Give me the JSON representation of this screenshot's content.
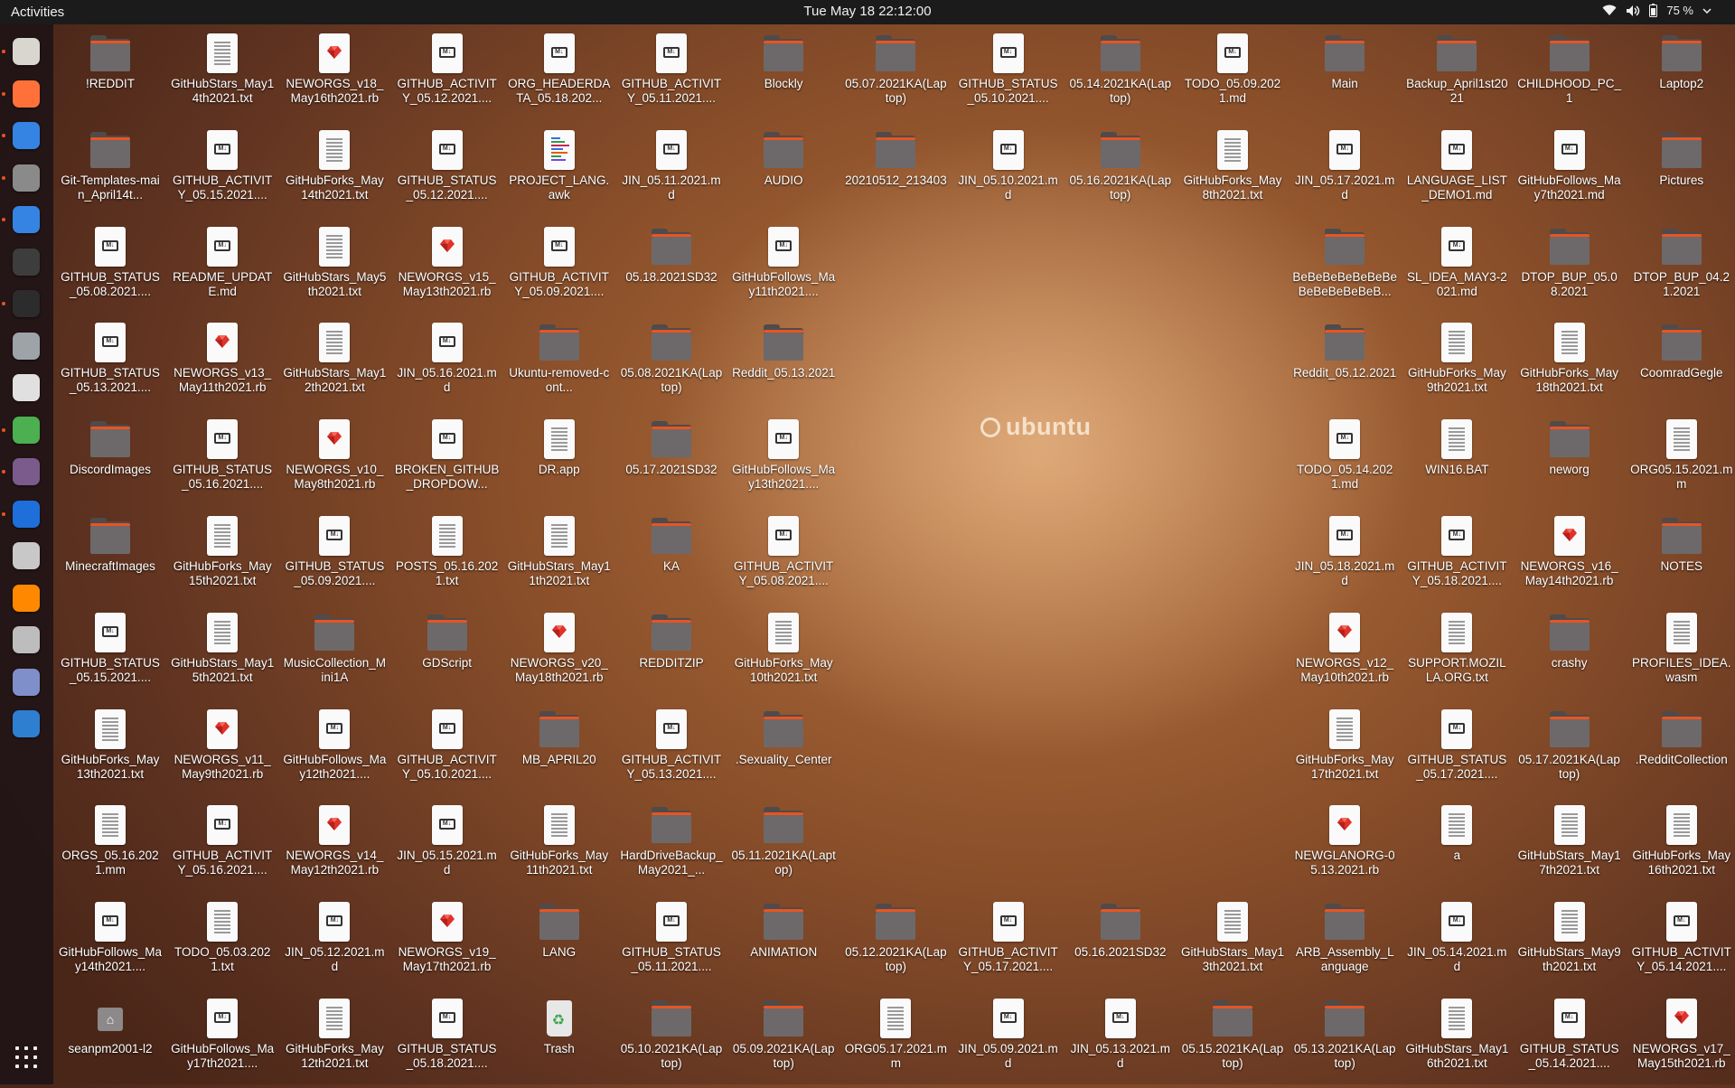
{
  "topbar": {
    "activities": "Activities",
    "clock": "Tue May 18  22:12:00",
    "battery_percent": "75 %"
  },
  "dock": [
    {
      "name": "files-icon",
      "color": "#d9d5cf",
      "running": true
    },
    {
      "name": "firefox-icon",
      "color": "#ff7139",
      "running": true
    },
    {
      "name": "text-editor-icon",
      "color": "#3584e4",
      "running": true
    },
    {
      "name": "settings-icon",
      "color": "#8a8a8a",
      "running": true
    },
    {
      "name": "help-icon",
      "color": "#3584e4",
      "running": true
    },
    {
      "name": "system-monitor-icon",
      "color": "#3d3d3d",
      "running": false
    },
    {
      "name": "terminal-icon",
      "color": "#2c2c2c",
      "running": true
    },
    {
      "name": "search-icon",
      "color": "#9ea3a8",
      "running": false
    },
    {
      "name": "sound-recorder-icon",
      "color": "#e0e0e0",
      "running": false
    },
    {
      "name": "extensions-icon",
      "color": "#4caf50",
      "running": true
    },
    {
      "name": "tweaks-icon",
      "color": "#7a5b8c",
      "running": true
    },
    {
      "name": "writer-icon",
      "color": "#1e6fd9",
      "running": true
    },
    {
      "name": "magnifier-icon",
      "color": "#c8c8c8",
      "running": false
    },
    {
      "name": "vlc-icon",
      "color": "#ff8800",
      "running": false
    },
    {
      "name": "disk-utility-icon",
      "color": "#bdbdbd",
      "running": false
    },
    {
      "name": "password-icon",
      "color": "#7f8fc9",
      "running": false
    },
    {
      "name": "virtualbox-icon",
      "color": "#2f7fd1",
      "running": false
    }
  ],
  "watermark": "ubuntu",
  "desktop_items": [
    {
      "col": 0,
      "row": 0,
      "type": "folder",
      "label": "!REDDIT"
    },
    {
      "col": 1,
      "row": 0,
      "type": "txt",
      "label": "GitHubStars_May14th2021.txt"
    },
    {
      "col": 2,
      "row": 0,
      "type": "rb",
      "label": "NEWORGS_v18_May16th2021.rb"
    },
    {
      "col": 3,
      "row": 0,
      "type": "md",
      "label": "GITHUB_ACTIVITY_05.12.2021...."
    },
    {
      "col": 4,
      "row": 0,
      "type": "md",
      "label": "ORG_HEADERDATA_05.18.202..."
    },
    {
      "col": 5,
      "row": 0,
      "type": "md",
      "label": "GITHUB_ACTIVITY_05.11.2021...."
    },
    {
      "col": 6,
      "row": 0,
      "type": "folder",
      "label": "Blockly"
    },
    {
      "col": 7,
      "row": 0,
      "type": "folder",
      "label": "05.07.2021KA(Laptop)"
    },
    {
      "col": 8,
      "row": 0,
      "type": "md",
      "label": "GITHUB_STATUS_05.10.2021...."
    },
    {
      "col": 9,
      "row": 0,
      "type": "folder",
      "label": "05.14.2021KA(Laptop)"
    },
    {
      "col": 10,
      "row": 0,
      "type": "md",
      "label": "TODO_05.09.2021.md"
    },
    {
      "col": 11,
      "row": 0,
      "type": "folder",
      "label": "Main"
    },
    {
      "col": 12,
      "row": 0,
      "type": "folder",
      "label": "Backup_April1st2021"
    },
    {
      "col": 13,
      "row": 0,
      "type": "folder",
      "label": "CHILDHOOD_PC_1"
    },
    {
      "col": 14,
      "row": 0,
      "type": "folder",
      "label": "Laptop2"
    },
    {
      "col": 0,
      "row": 1,
      "type": "folder",
      "label": "Git-Templates-main_April14t..."
    },
    {
      "col": 1,
      "row": 1,
      "type": "md",
      "label": "GITHUB_ACTIVITY_05.15.2021...."
    },
    {
      "col": 2,
      "row": 1,
      "type": "txt",
      "label": "GitHubForks_May14th2021.txt"
    },
    {
      "col": 3,
      "row": 1,
      "type": "md",
      "label": "GITHUB_STATUS_05.12.2021...."
    },
    {
      "col": 4,
      "row": 1,
      "type": "awk",
      "label": "PROJECT_LANG.awk"
    },
    {
      "col": 5,
      "row": 1,
      "type": "md",
      "label": "JIN_05.11.2021.md"
    },
    {
      "col": 6,
      "row": 1,
      "type": "folder",
      "label": "AUDIO"
    },
    {
      "col": 7,
      "row": 1,
      "type": "folder",
      "label": "20210512_213403"
    },
    {
      "col": 8,
      "row": 1,
      "type": "md",
      "label": "JIN_05.10.2021.md"
    },
    {
      "col": 9,
      "row": 1,
      "type": "folder",
      "label": "05.16.2021KA(Laptop)"
    },
    {
      "col": 10,
      "row": 1,
      "type": "txt",
      "label": "GitHubForks_May8th2021.txt"
    },
    {
      "col": 11,
      "row": 1,
      "type": "md",
      "label": "JIN_05.17.2021.md"
    },
    {
      "col": 12,
      "row": 1,
      "type": "md",
      "label": "LANGUAGE_LIST_DEMO1.md"
    },
    {
      "col": 13,
      "row": 1,
      "type": "md",
      "label": "GitHubFollows_May7th2021.md"
    },
    {
      "col": 14,
      "row": 1,
      "type": "folder",
      "label": "Pictures"
    },
    {
      "col": 0,
      "row": 2,
      "type": "md",
      "label": "GITHUB_STATUS_05.08.2021...."
    },
    {
      "col": 1,
      "row": 2,
      "type": "md",
      "label": "README_UPDATE.md"
    },
    {
      "col": 2,
      "row": 2,
      "type": "txt",
      "label": "GitHubStars_May5th2021.txt"
    },
    {
      "col": 3,
      "row": 2,
      "type": "rb",
      "label": "NEWORGS_v15_May13th2021.rb"
    },
    {
      "col": 4,
      "row": 2,
      "type": "md",
      "label": "GITHUB_ACTIVITY_05.09.2021...."
    },
    {
      "col": 5,
      "row": 2,
      "type": "folder",
      "label": "05.18.2021SD32"
    },
    {
      "col": 6,
      "row": 2,
      "type": "md",
      "label": "GitHubFollows_May11th2021...."
    },
    {
      "col": 11,
      "row": 2,
      "type": "folder",
      "label": "BeBeBeBeBeBeBeBeBeBeBeBeB..."
    },
    {
      "col": 12,
      "row": 2,
      "type": "md",
      "label": "SL_IDEA_MAY3-2021.md"
    },
    {
      "col": 13,
      "row": 2,
      "type": "folder",
      "label": "DTOP_BUP_05.08.2021"
    },
    {
      "col": 14,
      "row": 2,
      "type": "folder",
      "label": "DTOP_BUP_04.21.2021"
    },
    {
      "col": 0,
      "row": 3,
      "type": "md",
      "label": "GITHUB_STATUS_05.13.2021...."
    },
    {
      "col": 1,
      "row": 3,
      "type": "rb",
      "label": "NEWORGS_v13_May11th2021.rb"
    },
    {
      "col": 2,
      "row": 3,
      "type": "txt",
      "label": "GitHubStars_May12th2021.txt"
    },
    {
      "col": 3,
      "row": 3,
      "type": "md",
      "label": "JIN_05.16.2021.md"
    },
    {
      "col": 4,
      "row": 3,
      "type": "folder",
      "label": "Ukuntu-removed-cont..."
    },
    {
      "col": 5,
      "row": 3,
      "type": "folder",
      "label": "05.08.2021KA(Laptop)"
    },
    {
      "col": 6,
      "row": 3,
      "type": "folder",
      "label": "Reddit_05.13.2021"
    },
    {
      "col": 11,
      "row": 3,
      "type": "folder",
      "label": "Reddit_05.12.2021"
    },
    {
      "col": 12,
      "row": 3,
      "type": "txt",
      "label": "GitHubForks_May9th2021.txt"
    },
    {
      "col": 13,
      "row": 3,
      "type": "txt",
      "label": "GitHubForks_May18th2021.txt"
    },
    {
      "col": 14,
      "row": 3,
      "type": "folder",
      "label": "CoomradGegle"
    },
    {
      "col": 0,
      "row": 4,
      "type": "folder",
      "label": "DiscordImages"
    },
    {
      "col": 1,
      "row": 4,
      "type": "md",
      "label": "GITHUB_STATUS_05.16.2021...."
    },
    {
      "col": 2,
      "row": 4,
      "type": "rb",
      "label": "NEWORGS_v10_May8th2021.rb"
    },
    {
      "col": 3,
      "row": 4,
      "type": "md",
      "label": "BROKEN_GITHUB_DROPDOW..."
    },
    {
      "col": 4,
      "row": 4,
      "type": "txt",
      "label": "DR.app"
    },
    {
      "col": 5,
      "row": 4,
      "type": "folder",
      "label": "05.17.2021SD32"
    },
    {
      "col": 6,
      "row": 4,
      "type": "md",
      "label": "GitHubFollows_May13th2021...."
    },
    {
      "col": 11,
      "row": 4,
      "type": "md",
      "label": "TODO_05.14.2021.md"
    },
    {
      "col": 12,
      "row": 4,
      "type": "txt",
      "label": "WIN16.BAT"
    },
    {
      "col": 13,
      "row": 4,
      "type": "folder",
      "label": "neworg"
    },
    {
      "col": 14,
      "row": 4,
      "type": "txt",
      "label": "ORG05.15.2021.mm"
    },
    {
      "col": 0,
      "row": 5,
      "type": "folder",
      "label": "MinecraftImages"
    },
    {
      "col": 1,
      "row": 5,
      "type": "txt",
      "label": "GitHubForks_May15th2021.txt"
    },
    {
      "col": 2,
      "row": 5,
      "type": "md",
      "label": "GITHUB_STATUS_05.09.2021...."
    },
    {
      "col": 3,
      "row": 5,
      "type": "txt",
      "label": "POSTS_05.16.2021.txt"
    },
    {
      "col": 4,
      "row": 5,
      "type": "txt",
      "label": "GitHubStars_May11th2021.txt"
    },
    {
      "col": 5,
      "row": 5,
      "type": "folder",
      "label": "KA"
    },
    {
      "col": 6,
      "row": 5,
      "type": "md",
      "label": "GITHUB_ACTIVITY_05.08.2021...."
    },
    {
      "col": 11,
      "row": 5,
      "type": "md",
      "label": "JIN_05.18.2021.md"
    },
    {
      "col": 12,
      "row": 5,
      "type": "md",
      "label": "GITHUB_ACTIVITY_05.18.2021...."
    },
    {
      "col": 13,
      "row": 5,
      "type": "rb",
      "label": "NEWORGS_v16_May14th2021.rb"
    },
    {
      "col": 14,
      "row": 5,
      "type": "folder",
      "label": "NOTES"
    },
    {
      "col": 0,
      "row": 6,
      "type": "md",
      "label": "GITHUB_STATUS_05.15.2021...."
    },
    {
      "col": 1,
      "row": 6,
      "type": "txt",
      "label": "GitHubStars_May15th2021.txt"
    },
    {
      "col": 2,
      "row": 6,
      "type": "folder",
      "label": "MusicCollection_Mini1A"
    },
    {
      "col": 3,
      "row": 6,
      "type": "folder",
      "label": "GDScript"
    },
    {
      "col": 4,
      "row": 6,
      "type": "rb",
      "label": "NEWORGS_v20_May18th2021.rb"
    },
    {
      "col": 5,
      "row": 6,
      "type": "folder",
      "label": "REDDITZIP"
    },
    {
      "col": 6,
      "row": 6,
      "type": "txt",
      "label": "GitHubForks_May10th2021.txt"
    },
    {
      "col": 11,
      "row": 6,
      "type": "rb",
      "label": "NEWORGS_v12_May10th2021.rb"
    },
    {
      "col": 12,
      "row": 6,
      "type": "txt",
      "label": "SUPPORT.MOZILLA.ORG.txt"
    },
    {
      "col": 13,
      "row": 6,
      "type": "folder",
      "label": "crashy"
    },
    {
      "col": 14,
      "row": 6,
      "type": "txt",
      "label": "PROFILES_IDEA.wasm"
    },
    {
      "col": 0,
      "row": 7,
      "type": "txt",
      "label": "GitHubForks_May13th2021.txt"
    },
    {
      "col": 1,
      "row": 7,
      "type": "rb",
      "label": "NEWORGS_v11_May9th2021.rb"
    },
    {
      "col": 2,
      "row": 7,
      "type": "md",
      "label": "GitHubFollows_May12th2021...."
    },
    {
      "col": 3,
      "row": 7,
      "type": "md",
      "label": "GITHUB_ACTIVITY_05.10.2021...."
    },
    {
      "col": 4,
      "row": 7,
      "type": "folder",
      "label": "MB_APRIL20"
    },
    {
      "col": 5,
      "row": 7,
      "type": "md",
      "label": "GITHUB_ACTIVITY_05.13.2021...."
    },
    {
      "col": 6,
      "row": 7,
      "type": "folder",
      "label": ".Sexuality_Center"
    },
    {
      "col": 11,
      "row": 7,
      "type": "txt",
      "label": "GitHubForks_May17th2021.txt"
    },
    {
      "col": 12,
      "row": 7,
      "type": "md",
      "label": "GITHUB_STATUS_05.17.2021...."
    },
    {
      "col": 13,
      "row": 7,
      "type": "folder",
      "label": "05.17.2021KA(Laptop)"
    },
    {
      "col": 14,
      "row": 7,
      "type": "folder",
      "label": ".RedditCollection"
    },
    {
      "col": 0,
      "row": 8,
      "type": "txt",
      "label": "ORGS_05.16.2021.mm"
    },
    {
      "col": 1,
      "row": 8,
      "type": "md",
      "label": "GITHUB_ACTIVITY_05.16.2021...."
    },
    {
      "col": 2,
      "row": 8,
      "type": "rb",
      "label": "NEWORGS_v14_May12th2021.rb"
    },
    {
      "col": 3,
      "row": 8,
      "type": "md",
      "label": "JIN_05.15.2021.md"
    },
    {
      "col": 4,
      "row": 8,
      "type": "txt",
      "label": "GitHubForks_May11th2021.txt"
    },
    {
      "col": 5,
      "row": 8,
      "type": "folder",
      "label": "HardDriveBackup_May2021_..."
    },
    {
      "col": 6,
      "row": 8,
      "type": "folder",
      "label": "05.11.2021KA(Laptop)"
    },
    {
      "col": 11,
      "row": 8,
      "type": "rb",
      "label": "NEWGLANORG-05.13.2021.rb"
    },
    {
      "col": 12,
      "row": 8,
      "type": "txt",
      "label": "a"
    },
    {
      "col": 13,
      "row": 8,
      "type": "txt",
      "label": "GitHubStars_May17th2021.txt"
    },
    {
      "col": 14,
      "row": 8,
      "type": "txt",
      "label": "GitHubForks_May16th2021.txt"
    },
    {
      "col": 0,
      "row": 9,
      "type": "md",
      "label": "GitHubFollows_May14th2021...."
    },
    {
      "col": 1,
      "row": 9,
      "type": "txt",
      "label": "TODO_05.03.2021.txt"
    },
    {
      "col": 2,
      "row": 9,
      "type": "md",
      "label": "JIN_05.12.2021.md"
    },
    {
      "col": 3,
      "row": 9,
      "type": "rb",
      "label": "NEWORGS_v19_May17th2021.rb"
    },
    {
      "col": 4,
      "row": 9,
      "type": "folder",
      "label": "LANG"
    },
    {
      "col": 5,
      "row": 9,
      "type": "md",
      "label": "GITHUB_STATUS_05.11.2021...."
    },
    {
      "col": 6,
      "row": 9,
      "type": "folder",
      "label": "ANIMATION"
    },
    {
      "col": 7,
      "row": 9,
      "type": "folder",
      "label": "05.12.2021KA(Laptop)"
    },
    {
      "col": 8,
      "row": 9,
      "type": "md",
      "label": "GITHUB_ACTIVITY_05.17.2021...."
    },
    {
      "col": 9,
      "row": 9,
      "type": "folder",
      "label": "05.16.2021SD32"
    },
    {
      "col": 10,
      "row": 9,
      "type": "txt",
      "label": "GitHubStars_May13th2021.txt"
    },
    {
      "col": 11,
      "row": 9,
      "type": "folder",
      "label": "ARB_Assembly_Language"
    },
    {
      "col": 12,
      "row": 9,
      "type": "md",
      "label": "JIN_05.14.2021.md"
    },
    {
      "col": 13,
      "row": 9,
      "type": "txt",
      "label": "GitHubStars_May9th2021.txt"
    },
    {
      "col": 14,
      "row": 9,
      "type": "md",
      "label": "GITHUB_ACTIVITY_05.14.2021...."
    },
    {
      "col": 0,
      "row": 10,
      "type": "home",
      "label": "seanpm2001-l2"
    },
    {
      "col": 1,
      "row": 10,
      "type": "md",
      "label": "GitHubFollows_May17th2021...."
    },
    {
      "col": 2,
      "row": 10,
      "type": "txt",
      "label": "GitHubForks_May12th2021.txt"
    },
    {
      "col": 3,
      "row": 10,
      "type": "md",
      "label": "GITHUB_STATUS_05.18.2021...."
    },
    {
      "col": 4,
      "row": 10,
      "type": "trash",
      "label": "Trash"
    },
    {
      "col": 5,
      "row": 10,
      "type": "folder",
      "label": "05.10.2021KA(Laptop)"
    },
    {
      "col": 6,
      "row": 10,
      "type": "folder",
      "label": "05.09.2021KA(Laptop)"
    },
    {
      "col": 7,
      "row": 10,
      "type": "txt",
      "label": "ORG05.17.2021.mm"
    },
    {
      "col": 8,
      "row": 10,
      "type": "md",
      "label": "JIN_05.09.2021.md"
    },
    {
      "col": 9,
      "row": 10,
      "type": "md",
      "label": "JIN_05.13.2021.md"
    },
    {
      "col": 10,
      "row": 10,
      "type": "folder",
      "label": "05.15.2021KA(Laptop)"
    },
    {
      "col": 11,
      "row": 10,
      "type": "folder",
      "label": "05.13.2021KA(Laptop)"
    },
    {
      "col": 12,
      "row": 10,
      "type": "txt",
      "label": "GitHubStars_May16th2021.txt"
    },
    {
      "col": 13,
      "row": 10,
      "type": "md",
      "label": "GITHUB_STATUS_05.14.2021...."
    },
    {
      "col": 14,
      "row": 10,
      "type": "rb",
      "label": "NEWORGS_v17_May15th2021.rb"
    }
  ]
}
